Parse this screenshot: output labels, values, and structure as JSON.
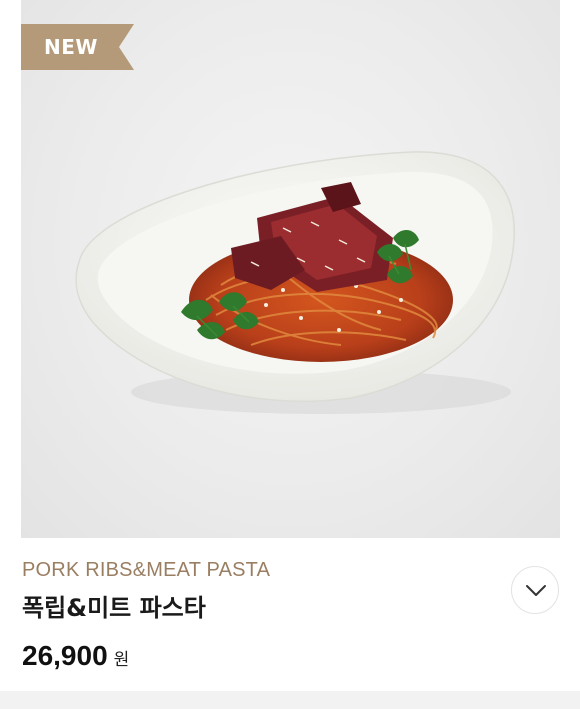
{
  "product": {
    "badge": "NEW",
    "name_en": "PORK RIBS&MEAT PASTA",
    "name_ko": "폭립&미트 파스타",
    "price": "26,900",
    "price_unit": "원",
    "image_icon": "pasta-dish-photo"
  },
  "controls": {
    "expand_icon": "chevron-down-icon"
  },
  "colors": {
    "badge_bg": "#b49a78",
    "english_name": "#9a7e62",
    "title_text": "#1a1a1a"
  }
}
